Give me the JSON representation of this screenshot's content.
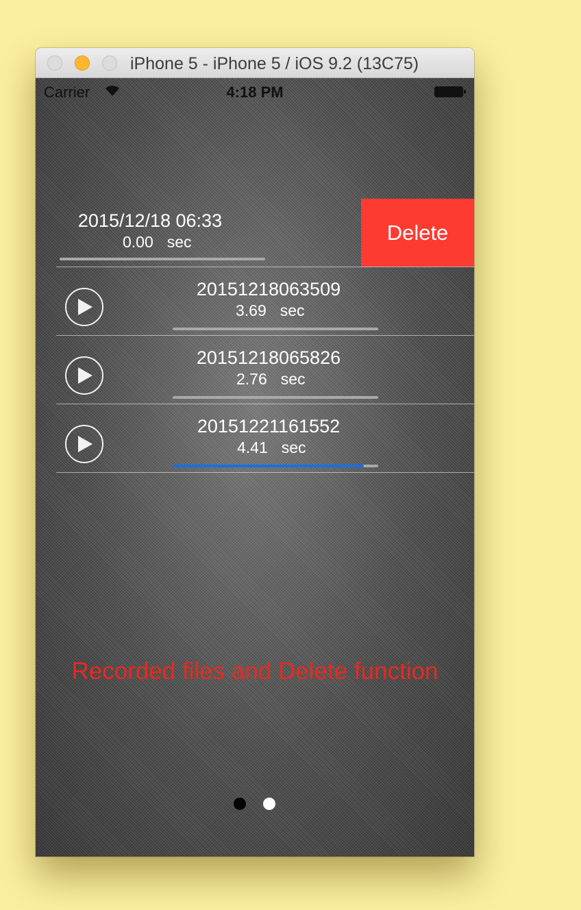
{
  "window": {
    "title": "iPhone 5 - iPhone 5 / iOS 9.2 (13C75)"
  },
  "status_bar": {
    "carrier": "Carrier",
    "time": "4:18 PM"
  },
  "recordings": [
    {
      "title": "2015/12/18  06:33",
      "duration": "0.00",
      "unit": "sec",
      "swiped": true,
      "progress": 0
    },
    {
      "title": "20151218063509",
      "duration": "3.69",
      "unit": "sec",
      "swiped": false,
      "progress": 0
    },
    {
      "title": "20151218065826",
      "duration": "2.76",
      "unit": "sec",
      "swiped": false,
      "progress": 0
    },
    {
      "title": "20151221161552",
      "duration": "4.41",
      "unit": "sec",
      "swiped": false,
      "progress": 0.93
    }
  ],
  "delete_label": "Delete",
  "caption": "Recorded files and Delete function",
  "page_control": {
    "count": 2,
    "current": 2
  },
  "colors": {
    "delete": "#fd3b30",
    "caption": "#e8291f",
    "progress": "#1a6fe0",
    "background": "#fbeea0"
  }
}
